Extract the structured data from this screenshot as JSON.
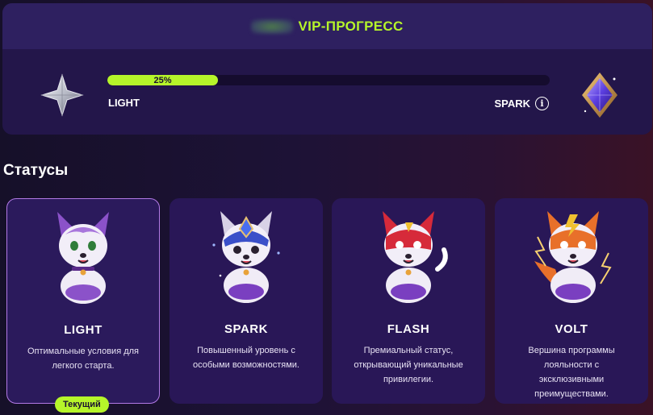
{
  "vip": {
    "title": "VIP-ПРОГРЕСС",
    "progress_percent": 25,
    "progress_label": "25%",
    "current_level": "LIGHT",
    "next_level": "SPARK",
    "info_glyph": "i",
    "icons": {
      "current": "silver-star-icon",
      "next": "purple-diamond-icon",
      "info": "info-icon"
    },
    "accent_color": "#b6f52a"
  },
  "statuses": {
    "title": "Статусы",
    "current_badge": "Текущий",
    "cards": [
      {
        "name": "LIGHT",
        "description": "Оптимальные условия для легкого старта.",
        "current": true,
        "mascot_color": "#8b52c9"
      },
      {
        "name": "SPARK",
        "description": "Повышенный уровень с особыми возможностями.",
        "current": false,
        "mascot_color": "#3a4fc9"
      },
      {
        "name": "FLASH",
        "description": "Премиальный статус, открывающий уникальные привилегии.",
        "current": false,
        "mascot_color": "#d62a3a"
      },
      {
        "name": "VOLT",
        "description": "Вершина программы лояльности с эксклюзивными преимуществами.",
        "current": false,
        "mascot_color": "#e8702a"
      }
    ]
  }
}
